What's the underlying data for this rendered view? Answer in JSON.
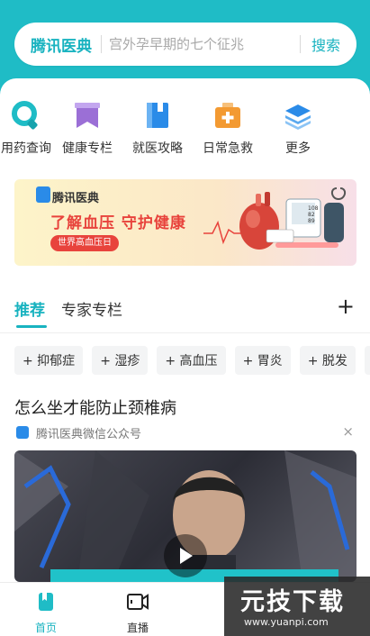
{
  "search": {
    "brand": "腾讯医典",
    "placeholder": "宫外孕早期的七个征兆",
    "button_label": "搜索"
  },
  "quick_actions": [
    {
      "label": "用药查询",
      "icon": "pill-search-icon",
      "color": "#1fbcc6"
    },
    {
      "label": "健康专栏",
      "icon": "bookmark-folder-icon",
      "color": "#9b6fd6"
    },
    {
      "label": "就医攻略",
      "icon": "book-icon",
      "color": "#2a8be8"
    },
    {
      "label": "日常急救",
      "icon": "first-aid-kit-icon",
      "color": "#f39a32"
    },
    {
      "label": "更多",
      "icon": "layers-icon",
      "color": "#2a8be8"
    }
  ],
  "banner": {
    "brand": "腾讯医典",
    "title": "了解血压 守护健康",
    "tag": "世界高血压日",
    "blood_pressure_display": [
      "108",
      "82",
      "89"
    ]
  },
  "tabs": {
    "items": [
      {
        "label": "推荐",
        "active": true
      },
      {
        "label": "专家专栏",
        "active": false
      }
    ],
    "add_label": "+"
  },
  "chips": [
    "+ 抑郁症",
    "+ 湿疹",
    "+ 高血压",
    "+ 胃炎",
    "+ 脱发",
    "+"
  ],
  "article": {
    "title": "怎么坐才能防止颈椎病",
    "source": "腾讯医典微信公众号",
    "close_label": "×"
  },
  "bottom_nav": [
    {
      "label": "首页",
      "icon": "home-bookmark-icon",
      "active": true
    },
    {
      "label": "直播",
      "icon": "video-camera-icon",
      "active": false
    }
  ],
  "watermark": {
    "title": "元技下载",
    "url": "www.yuanpi.com"
  },
  "colors": {
    "brand_teal": "#1fbcc6",
    "accent_red": "#e8433c"
  }
}
